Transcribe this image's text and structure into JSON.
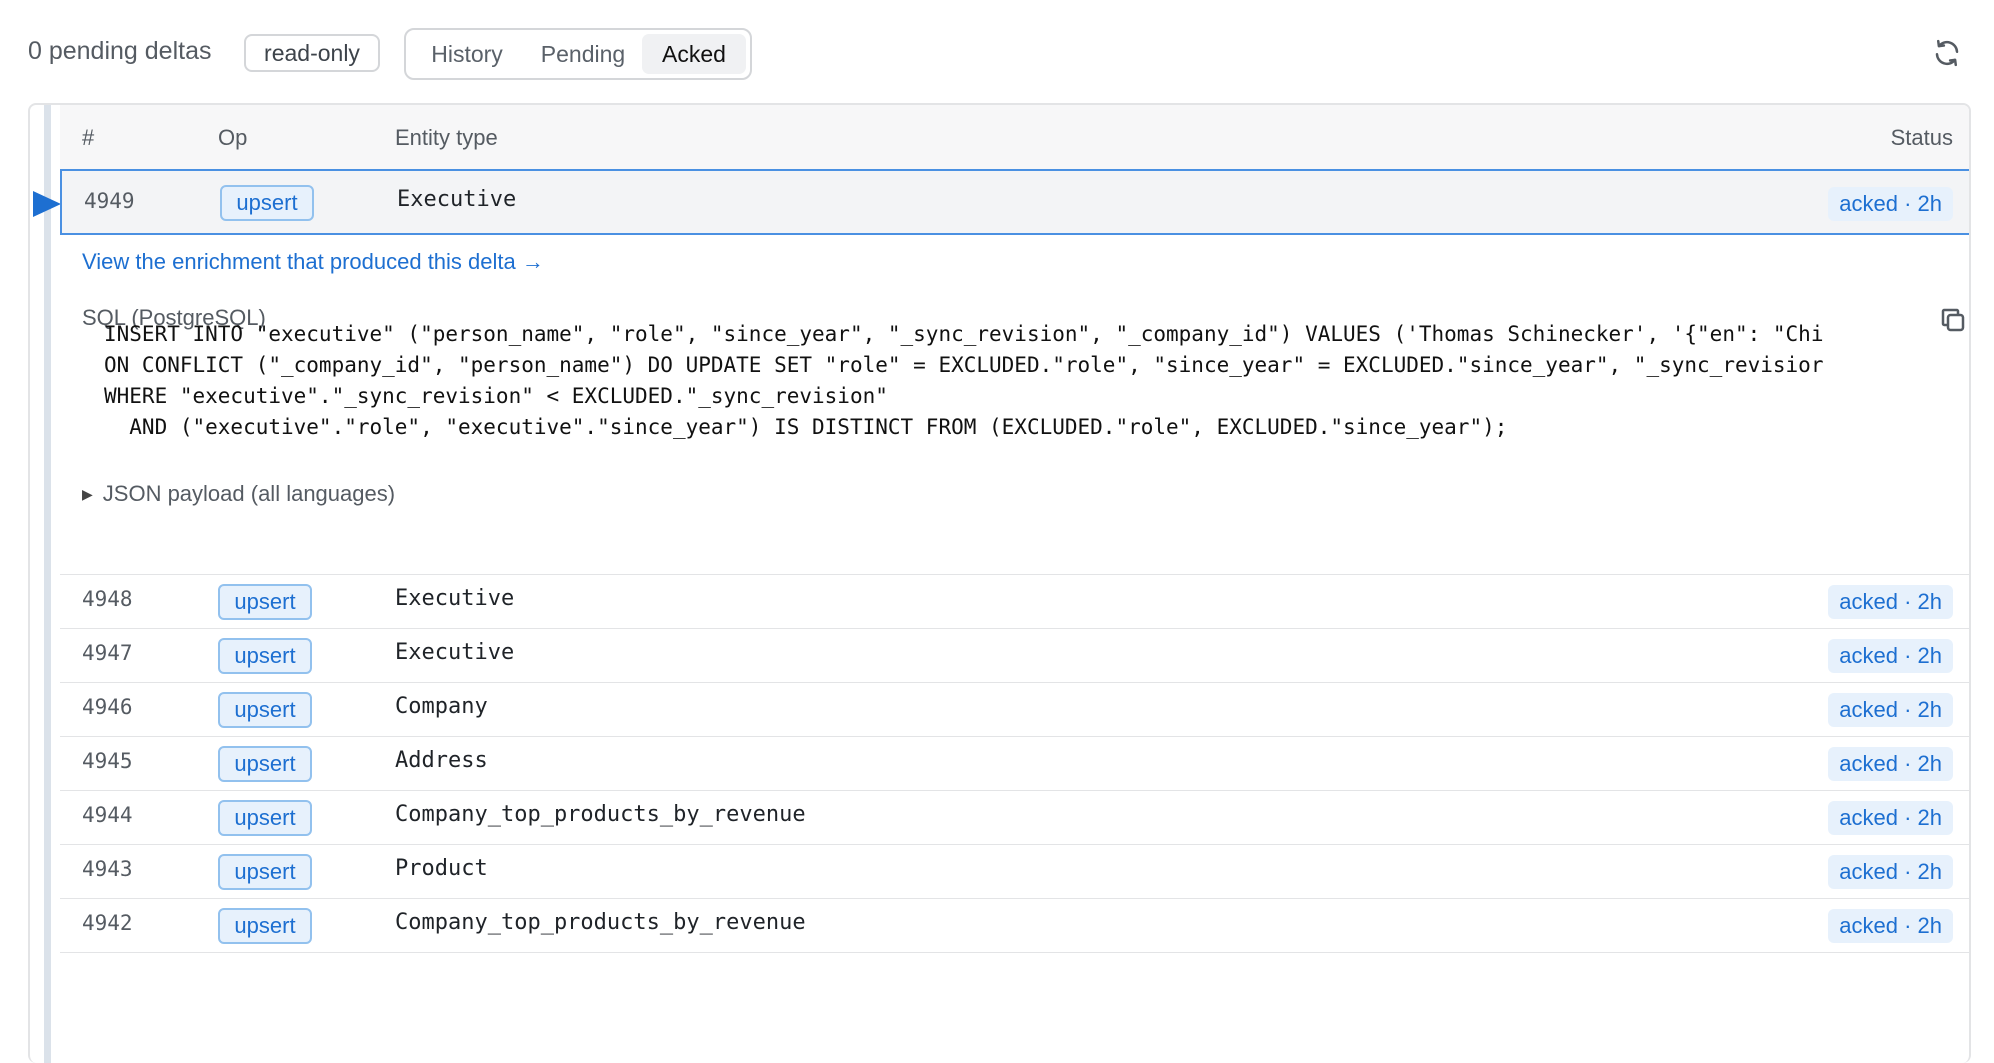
{
  "toolbar": {
    "pending_text": "0 pending deltas",
    "readonly_badge": "read-only",
    "tabs": [
      "History",
      "Pending",
      "Acked"
    ],
    "active_tab": "Acked",
    "refresh_icon": "refresh-icon"
  },
  "table": {
    "headers": {
      "num": "#",
      "op": "Op",
      "entity": "Entity type",
      "status": "Status"
    },
    "rows": [
      {
        "num": "4949",
        "op": "upsert",
        "entity": "Executive",
        "status": "acked · 2h"
      },
      {
        "num": "4948",
        "op": "upsert",
        "entity": "Executive",
        "status": "acked · 2h"
      },
      {
        "num": "4947",
        "op": "upsert",
        "entity": "Executive",
        "status": "acked · 2h"
      },
      {
        "num": "4946",
        "op": "upsert",
        "entity": "Company",
        "status": "acked · 2h"
      },
      {
        "num": "4945",
        "op": "upsert",
        "entity": "Address",
        "status": "acked · 2h"
      },
      {
        "num": "4944",
        "op": "upsert",
        "entity": "Company_top_products_by_revenue",
        "status": "acked · 2h"
      },
      {
        "num": "4943",
        "op": "upsert",
        "entity": "Product",
        "status": "acked · 2h"
      },
      {
        "num": "4942",
        "op": "upsert",
        "entity": "Company_top_products_by_revenue",
        "status": "acked · 2h"
      }
    ]
  },
  "detail": {
    "enrichment_link": "View the enrichment that produced this delta →",
    "sql_label": "SQL (PostgreSQL)",
    "sql_code": "INSERT INTO \"executive\" (\"person_name\", \"role\", \"since_year\", \"_sync_revision\", \"_company_id\") VALUES ('Thomas Schinecker', '{\"en\": \"Chi\nON CONFLICT (\"_company_id\", \"person_name\") DO UPDATE SET \"role\" = EXCLUDED.\"role\", \"since_year\" = EXCLUDED.\"since_year\", \"_sync_revisior\nWHERE \"executive\".\"_sync_revision\" < EXCLUDED.\"_sync_revision\"\n  AND (\"executive\".\"role\", \"executive\".\"since_year\") IS DISTINCT FROM (EXCLUDED.\"role\", EXCLUDED.\"since_year\");",
    "json_toggle": "JSON payload (all languages)"
  },
  "colors": {
    "accent": "#1d6fd1",
    "badge_bg": "#e7f1fc",
    "selected_border": "#4a90e2"
  }
}
